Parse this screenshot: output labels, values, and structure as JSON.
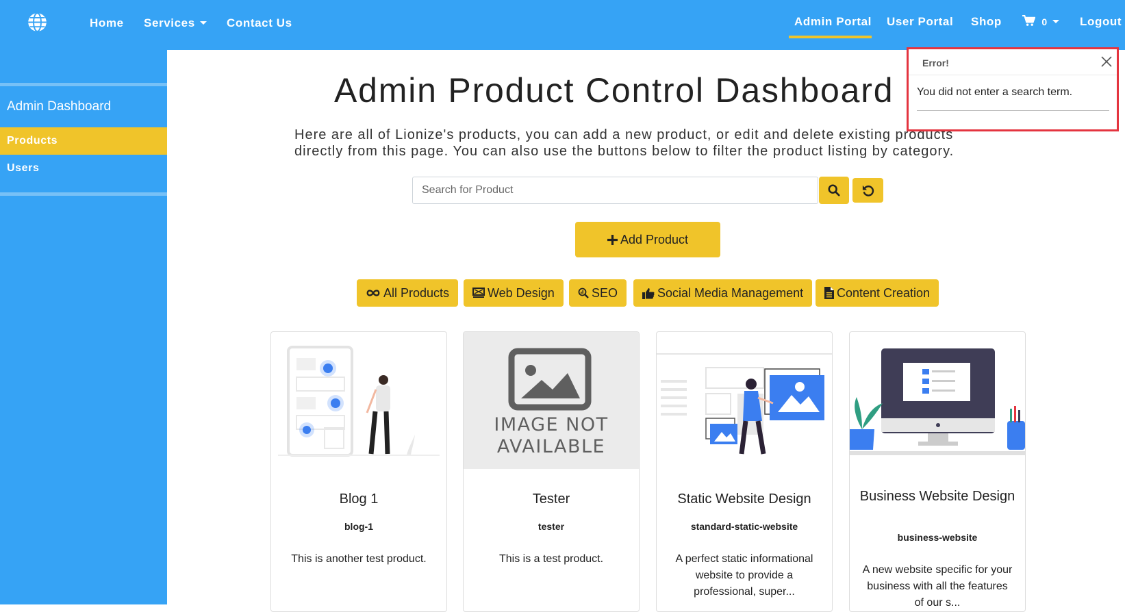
{
  "nav": {
    "home": "Home",
    "services": "Services",
    "contact": "Contact Us",
    "admin_portal": "Admin Portal",
    "user_portal": "User Portal",
    "shop": "Shop",
    "cart_count": "0",
    "logout": "Logout"
  },
  "sidebar": {
    "title": "Admin Dashboard",
    "items": [
      {
        "label": "Products",
        "active": true
      },
      {
        "label": "Users",
        "active": false
      }
    ]
  },
  "main": {
    "title": "Admin Product Control Dashboard",
    "intro": "Here are all of Lionize's products, you can add a new product, or edit and delete existing products directly from this page. You can also use the buttons below to filter the product listing by category.",
    "search_placeholder": "Search for Product",
    "add_product": "Add Product",
    "filters": [
      "All Products",
      "Web Design",
      "SEO",
      "Social Media Management",
      "Content Creation"
    ]
  },
  "products": [
    {
      "title": "Blog 1",
      "slug": "blog-1",
      "description": "This is another test product.",
      "image": "blog-illustration"
    },
    {
      "title": "Tester",
      "slug": "tester",
      "description": "This is a test product.",
      "image": "image-not-available",
      "image_text_1": "IMAGE NOT",
      "image_text_2": "AVAILABLE"
    },
    {
      "title": "Static Website Design",
      "slug": "standard-static-website",
      "description": "A perfect static informational website to provide a professional, super...",
      "image": "static-website-illustration"
    },
    {
      "title": "Business Website Design",
      "slug": "business-website",
      "description": "A new website specific for your business with all the features of our s...",
      "image": "business-website-illustration"
    }
  ],
  "toast": {
    "title": "Error!",
    "message": "You did not enter a search term."
  },
  "colors": {
    "nav_blue": "#36a3f5",
    "accent_yellow": "#f0c42a",
    "error_red": "#e4343f"
  }
}
